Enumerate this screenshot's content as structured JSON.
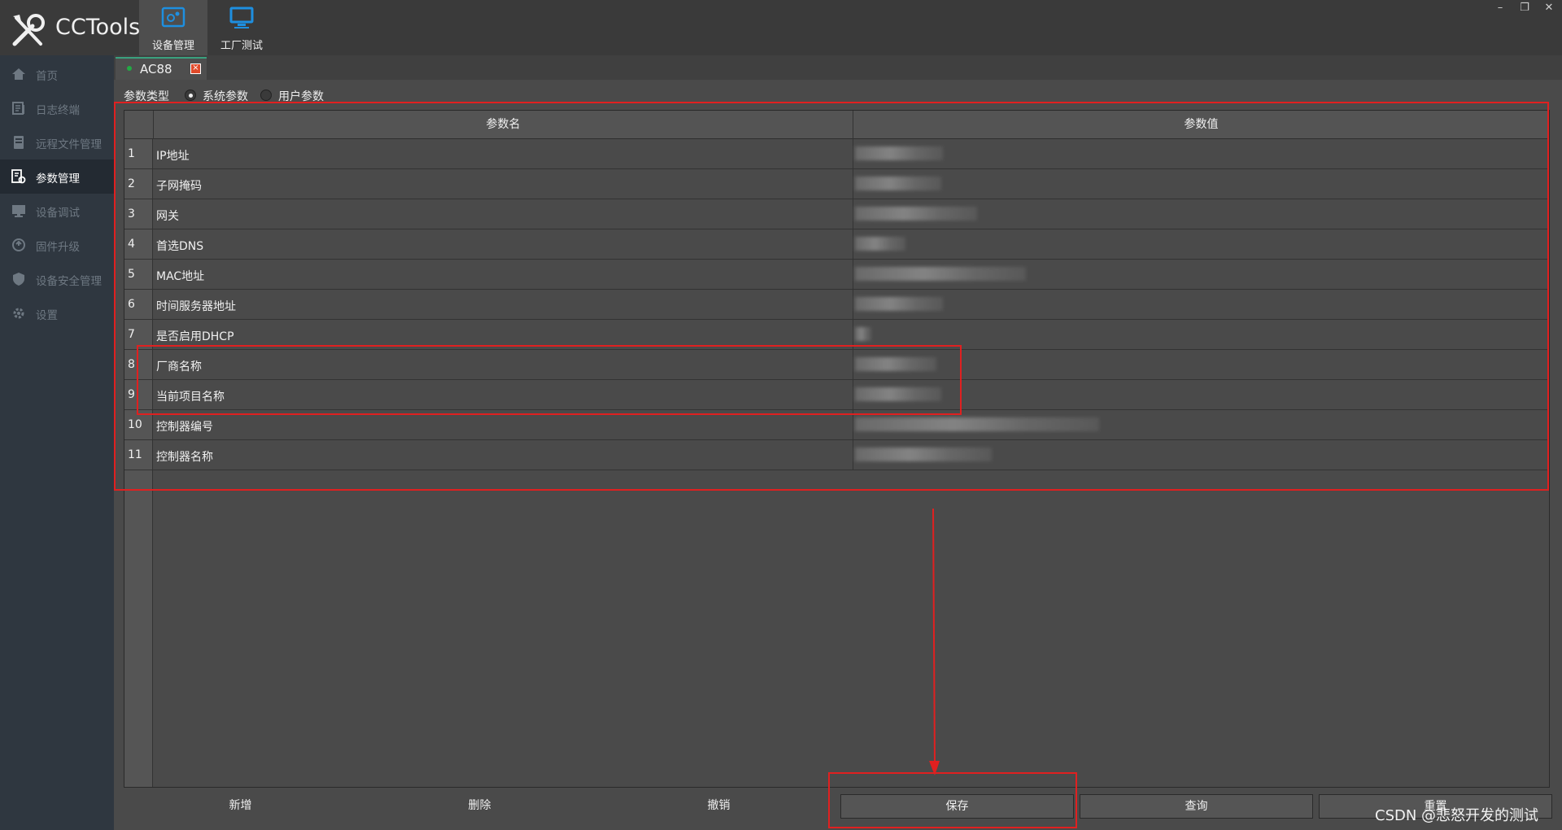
{
  "app": {
    "title": "CCTools"
  },
  "modules": [
    {
      "label": "设备管理",
      "icon": "device-manage-icon",
      "active": true
    },
    {
      "label": "工厂测试",
      "icon": "monitor-icon",
      "active": false
    }
  ],
  "window_controls": {
    "minimize": "–",
    "restore": "❐",
    "close": "✕"
  },
  "sidebar": {
    "items": [
      {
        "label": "首页",
        "icon": "home-icon"
      },
      {
        "label": "日志终端",
        "icon": "log-terminal-icon"
      },
      {
        "label": "远程文件管理",
        "icon": "file-icon"
      },
      {
        "label": "参数管理",
        "icon": "param-settings-icon",
        "active": true
      },
      {
        "label": "设备调试",
        "icon": "debug-monitor-icon"
      },
      {
        "label": "固件升级",
        "icon": "upgrade-icon"
      },
      {
        "label": "设备安全管理",
        "icon": "shield-icon"
      },
      {
        "label": "设置",
        "icon": "gear-icon"
      }
    ]
  },
  "doc_tab": {
    "label": "AC88",
    "close": "×"
  },
  "param_type": {
    "label": "参数类型",
    "options": [
      {
        "label": "系统参数",
        "checked": true
      },
      {
        "label": "用户参数",
        "checked": false
      }
    ]
  },
  "table": {
    "headers": {
      "name": "参数名",
      "value": "参数值"
    },
    "rows": [
      {
        "index": "1",
        "name": "IP地址"
      },
      {
        "index": "2",
        "name": "子网掩码"
      },
      {
        "index": "3",
        "name": "网关"
      },
      {
        "index": "4",
        "name": "首选DNS"
      },
      {
        "index": "5",
        "name": "MAC地址"
      },
      {
        "index": "6",
        "name": "时间服务器地址"
      },
      {
        "index": "7",
        "name": "是否启用DHCP"
      },
      {
        "index": "8",
        "name": "厂商名称"
      },
      {
        "index": "9",
        "name": "当前项目名称"
      },
      {
        "index": "10",
        "name": "控制器编号"
      },
      {
        "index": "11",
        "name": "控制器名称"
      }
    ]
  },
  "buttons": {
    "add": "新增",
    "delete": "删除",
    "undo": "撤销",
    "save": "保存",
    "query": "查询",
    "reset": "重置"
  },
  "watermark": "CSDN @悲怒开发的测试",
  "colors": {
    "annotation": "#e02020",
    "accent": "#1e8fe0",
    "sidebar_bg": "#2f3740",
    "active_tab_border": "#3aa17e"
  }
}
